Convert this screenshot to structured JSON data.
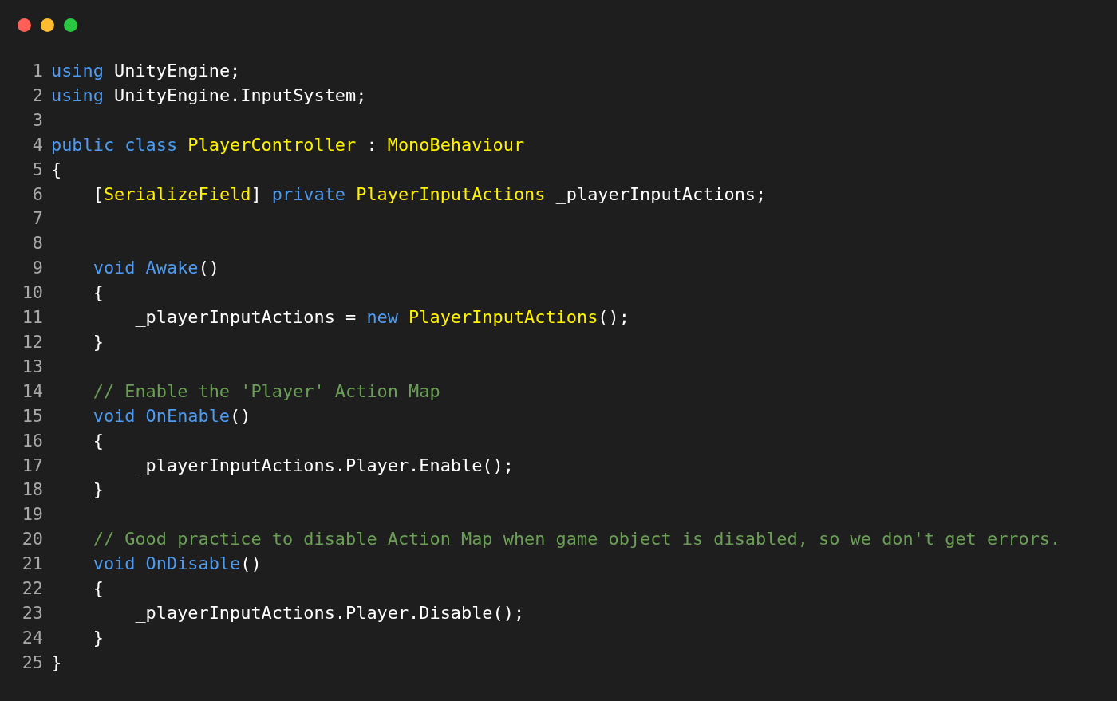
{
  "window_controls": [
    {
      "color": "#ff5f57"
    },
    {
      "color": "#febc2e"
    },
    {
      "color": "#28c840"
    }
  ],
  "lines": [
    {
      "number": "1",
      "tokens": [
        {
          "kind": "keyword",
          "text": "using"
        },
        {
          "kind": "plain",
          "text": " UnityEngine;"
        }
      ]
    },
    {
      "number": "2",
      "tokens": [
        {
          "kind": "keyword",
          "text": "using"
        },
        {
          "kind": "plain",
          "text": " UnityEngine.InputSystem;"
        }
      ]
    },
    {
      "number": "3"
    },
    {
      "number": "4",
      "tokens": [
        {
          "kind": "keyword",
          "text": "public class "
        },
        {
          "kind": "type",
          "text": "PlayerController"
        },
        {
          "kind": "plain",
          "text": " : "
        },
        {
          "kind": "type",
          "text": "MonoBehaviour"
        }
      ]
    },
    {
      "number": "5",
      "tokens": [
        {
          "kind": "plain",
          "text": "{"
        }
      ]
    },
    {
      "number": "6",
      "tokens": [
        {
          "kind": "plain",
          "text": "    ["
        },
        {
          "kind": "type",
          "text": "SerializeField"
        },
        {
          "kind": "plain",
          "text": "] "
        },
        {
          "kind": "keyword",
          "text": "private "
        },
        {
          "kind": "type",
          "text": "PlayerInputActions"
        },
        {
          "kind": "plain",
          "text": " _playerInputActions;"
        }
      ]
    },
    {
      "number": "7"
    },
    {
      "number": "8"
    },
    {
      "number": "9",
      "tokens": [
        {
          "kind": "keyword",
          "text": "    void Awake"
        },
        {
          "kind": "plain",
          "text": "()"
        }
      ]
    },
    {
      "number": "10",
      "tokens": [
        {
          "kind": "plain",
          "text": "    {"
        }
      ]
    },
    {
      "number": "11",
      "tokens": [
        {
          "kind": "plain",
          "text": "        _playerInputActions = "
        },
        {
          "kind": "keyword",
          "text": "new "
        },
        {
          "kind": "type",
          "text": "PlayerInputActions"
        },
        {
          "kind": "plain",
          "text": "();"
        }
      ]
    },
    {
      "number": "12",
      "tokens": [
        {
          "kind": "plain",
          "text": "    }"
        }
      ]
    },
    {
      "number": "13"
    },
    {
      "number": "14",
      "tokens": [
        {
          "kind": "comment",
          "text": "    // Enable the 'Player' Action Map"
        }
      ]
    },
    {
      "number": "15",
      "tokens": [
        {
          "kind": "keyword",
          "text": "    void OnEnable"
        },
        {
          "kind": "plain",
          "text": "()"
        }
      ]
    },
    {
      "number": "16",
      "tokens": [
        {
          "kind": "plain",
          "text": "    {"
        }
      ]
    },
    {
      "number": "17",
      "tokens": [
        {
          "kind": "plain",
          "text": "        _playerInputActions.Player.Enable();"
        }
      ]
    },
    {
      "number": "18",
      "tokens": [
        {
          "kind": "plain",
          "text": "    }"
        }
      ]
    },
    {
      "number": "19"
    },
    {
      "number": "20",
      "tokens": [
        {
          "kind": "comment",
          "text": "    // Good practice to disable Action Map when game object is disabled, so we don't get errors."
        }
      ]
    },
    {
      "number": "21",
      "tokens": [
        {
          "kind": "keyword",
          "text": "    void OnDisable"
        },
        {
          "kind": "plain",
          "text": "()"
        }
      ]
    },
    {
      "number": "22",
      "tokens": [
        {
          "kind": "plain",
          "text": "    {"
        }
      ]
    },
    {
      "number": "23",
      "tokens": [
        {
          "kind": "plain",
          "text": "        _playerInputActions.Player.Disable();"
        }
      ]
    },
    {
      "number": "24",
      "tokens": [
        {
          "kind": "plain",
          "text": "    }"
        }
      ]
    },
    {
      "number": "25",
      "tokens": [
        {
          "kind": "plain",
          "text": "}"
        }
      ]
    }
  ]
}
